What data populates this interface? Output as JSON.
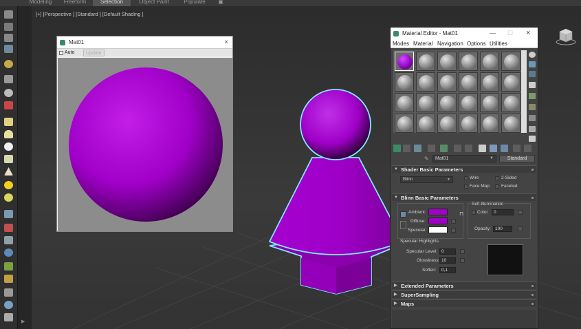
{
  "ribbon": {
    "tabs": [
      "Modeling",
      "Freeform",
      "Selection",
      "Object Paint",
      "Populate"
    ],
    "active_tab": "Selection"
  },
  "viewport": {
    "label": "[+] [Perspective ] [Standard ] [Default Shading ]"
  },
  "preview_window": {
    "title": "Mat01",
    "close_glyph": "×",
    "auto_label": "Auto",
    "update_label": "Update"
  },
  "material_editor": {
    "title": "Material Editor - Mat01",
    "window_buttons": [
      "—",
      "☐",
      "×"
    ],
    "menu": [
      "Modes",
      "Material",
      "Navigation",
      "Options",
      "Utilities"
    ],
    "material_name": "Mat01",
    "material_type": "Standard",
    "shader_rollout": {
      "title": "Shader Basic Parameters",
      "shader": "Blinn",
      "wire_label": "Wire",
      "two_sided_label": "2-Sided",
      "face_map_label": "Face Map",
      "faceted_label": "Faceted"
    },
    "blinn_rollout": {
      "title": "Blinn Basic Parameters",
      "ambient_label": "Ambient:",
      "diffuse_label": "Diffuse:",
      "specular_label": "Specular:",
      "self_illum_label": "Self-Illumination",
      "color_label": "Color",
      "color_value": "0",
      "opacity_label": "Opacity:",
      "opacity_value": "100",
      "specular_highlights_label": "Specular Highlights",
      "specular_level_label": "Specular Level:",
      "specular_level_value": "0",
      "glossiness_label": "Glossiness:",
      "glossiness_value": "10",
      "soften_label": "Soften:",
      "soften_value": "0,1"
    },
    "collapsed_rollouts": [
      "Extended Parameters",
      "SuperSampling",
      "Maps"
    ],
    "colors": {
      "ambient": "#a000c8",
      "diffuse": "#a000c8",
      "specular": "#ffffff",
      "material_color": "#a000c8"
    }
  },
  "icons": {
    "close": "close-icon",
    "viewcube": "viewcube-icon"
  }
}
